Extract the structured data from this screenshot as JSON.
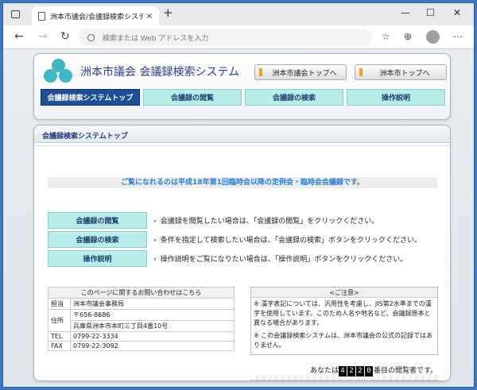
{
  "browser": {
    "tab_title": "洲本市議会/会議録検索システム",
    "tab_close": "×",
    "new_tab": "+",
    "address_placeholder": "検索または Web アドレスを入力",
    "window_min": "—",
    "window_max": "☐",
    "window_close": "✕"
  },
  "header": {
    "site_title": "洲本市議会 会議録検索システム",
    "btn_council": "洲本市議会トップへ",
    "btn_city": "洲本市トップへ",
    "nav": [
      "会議録検索システムトップ",
      "会議録の閲覧",
      "会議録の検索",
      "操作説明"
    ]
  },
  "main": {
    "title": "会議録検索システムトップ",
    "notice": "ご覧になれるのは平成18年第1回臨時会以降の定例会・臨時会会議録です。",
    "functions": [
      {
        "label": "会議録の閲覧",
        "desc": "会議録を閲覧したい場合は、「会議録の閲覧」をクリックください。"
      },
      {
        "label": "会議録の検索",
        "desc": "条件を指定して検索したい場合は、「会議録の検索」ボタンをクリックください。"
      },
      {
        "label": "操作説明",
        "desc": "操作説明をご覧になりたい場合は、「操作説明」ボタンをクリックください。"
      }
    ],
    "contact": {
      "caption": "このページに関するお問い合わせはこちら",
      "rows": [
        {
          "k": "担当",
          "v": "洲本市議会事務局"
        },
        {
          "k": "住所",
          "v": "〒656-8686"
        },
        {
          "k": "",
          "v": "兵庫県洲本市本町三丁目4番10号"
        },
        {
          "k": "TEL",
          "v": "0799-22-3334"
        },
        {
          "k": "FAX",
          "v": "0799-22-3092"
        }
      ]
    },
    "caution": {
      "caption": "<ご注意>",
      "p1": "※ 漢字表記については、汎用性を考慮し、JIS第2水準までの漢字を使用しています。このため人名や地名など、会議録原本と異なる場合があります。",
      "p2": "※ この会議録検索システムは、洲本市議会の公式の記録ではありません。"
    },
    "counter": {
      "prefix": "あなたは",
      "digits": [
        "4",
        "2",
        "2",
        "0"
      ],
      "suffix": "番目の閲覧者です。"
    }
  }
}
